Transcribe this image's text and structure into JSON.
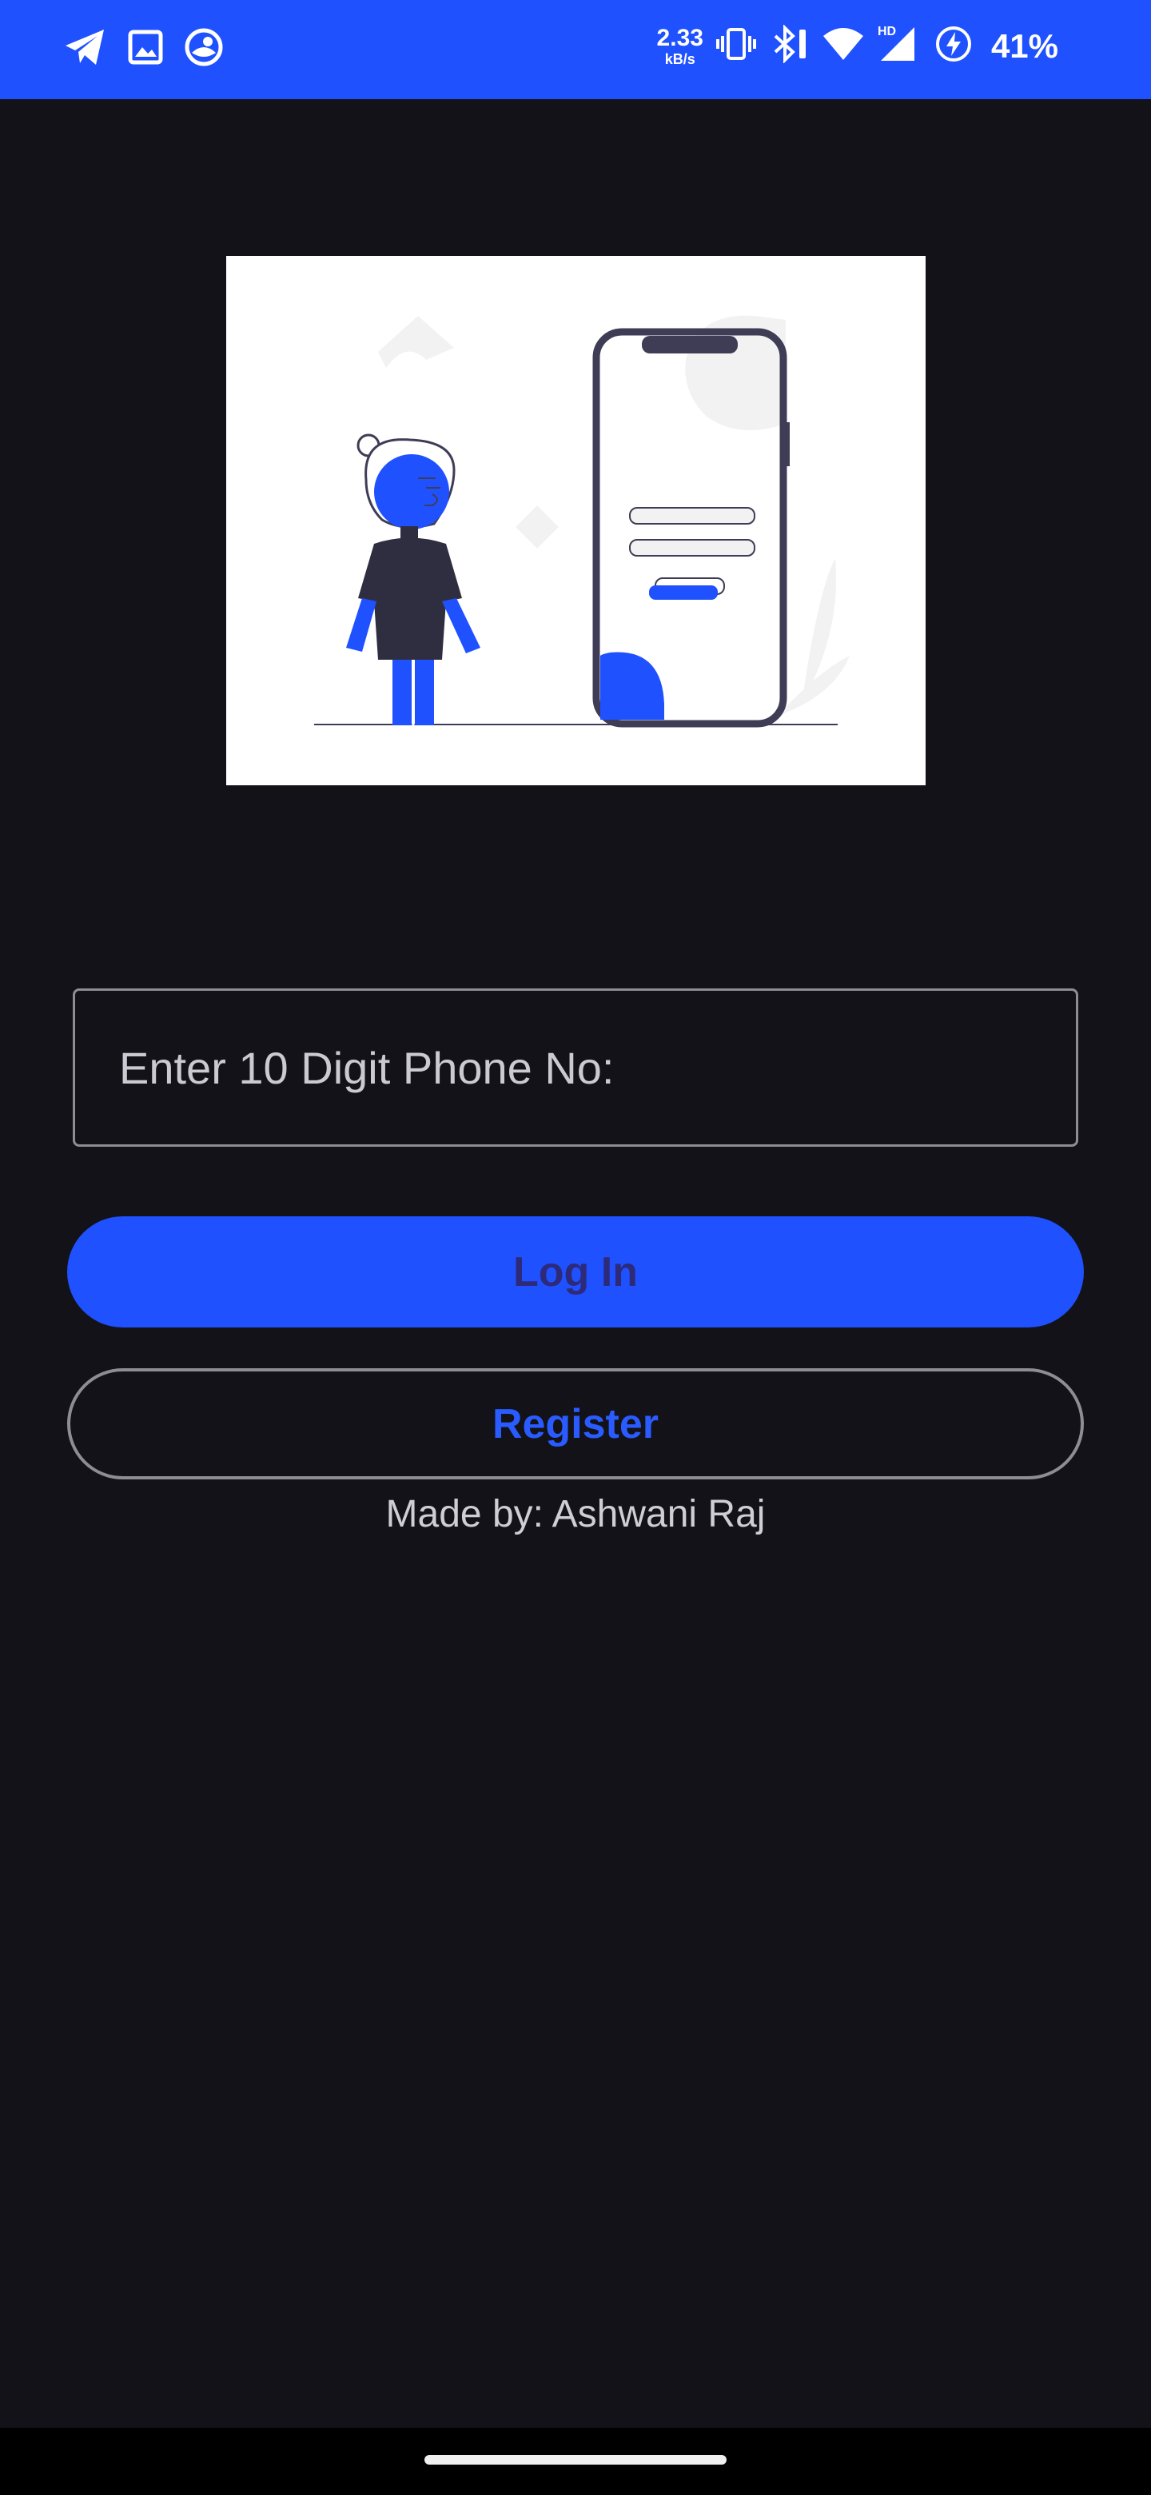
{
  "status_bar": {
    "speed_value": "2.33",
    "speed_unit": "kB/s",
    "network_badge": "HD",
    "battery": "41%",
    "left_icons": [
      "telegram-icon",
      "gallery-icon",
      "app-icon"
    ],
    "right_icons": [
      "vibrate-icon",
      "bluetooth-icon",
      "wifi-icon",
      "signal-icon",
      "battery-saver-icon"
    ]
  },
  "illustration": {
    "description_icon": "login-illustration",
    "colors": {
      "accent": "#1f51ff",
      "dark": "#3f3d56",
      "light": "#f2f2f2"
    }
  },
  "form": {
    "phone_placeholder": "Enter 10 Digit Phone No:",
    "phone_value": ""
  },
  "buttons": {
    "login_label": "Log In",
    "register_label": "Register"
  },
  "footer": {
    "credit": "Made by: Ashwani Raj"
  },
  "theme": {
    "background": "#131218",
    "accent": "#1f51ff",
    "border": "#8e8d95"
  }
}
